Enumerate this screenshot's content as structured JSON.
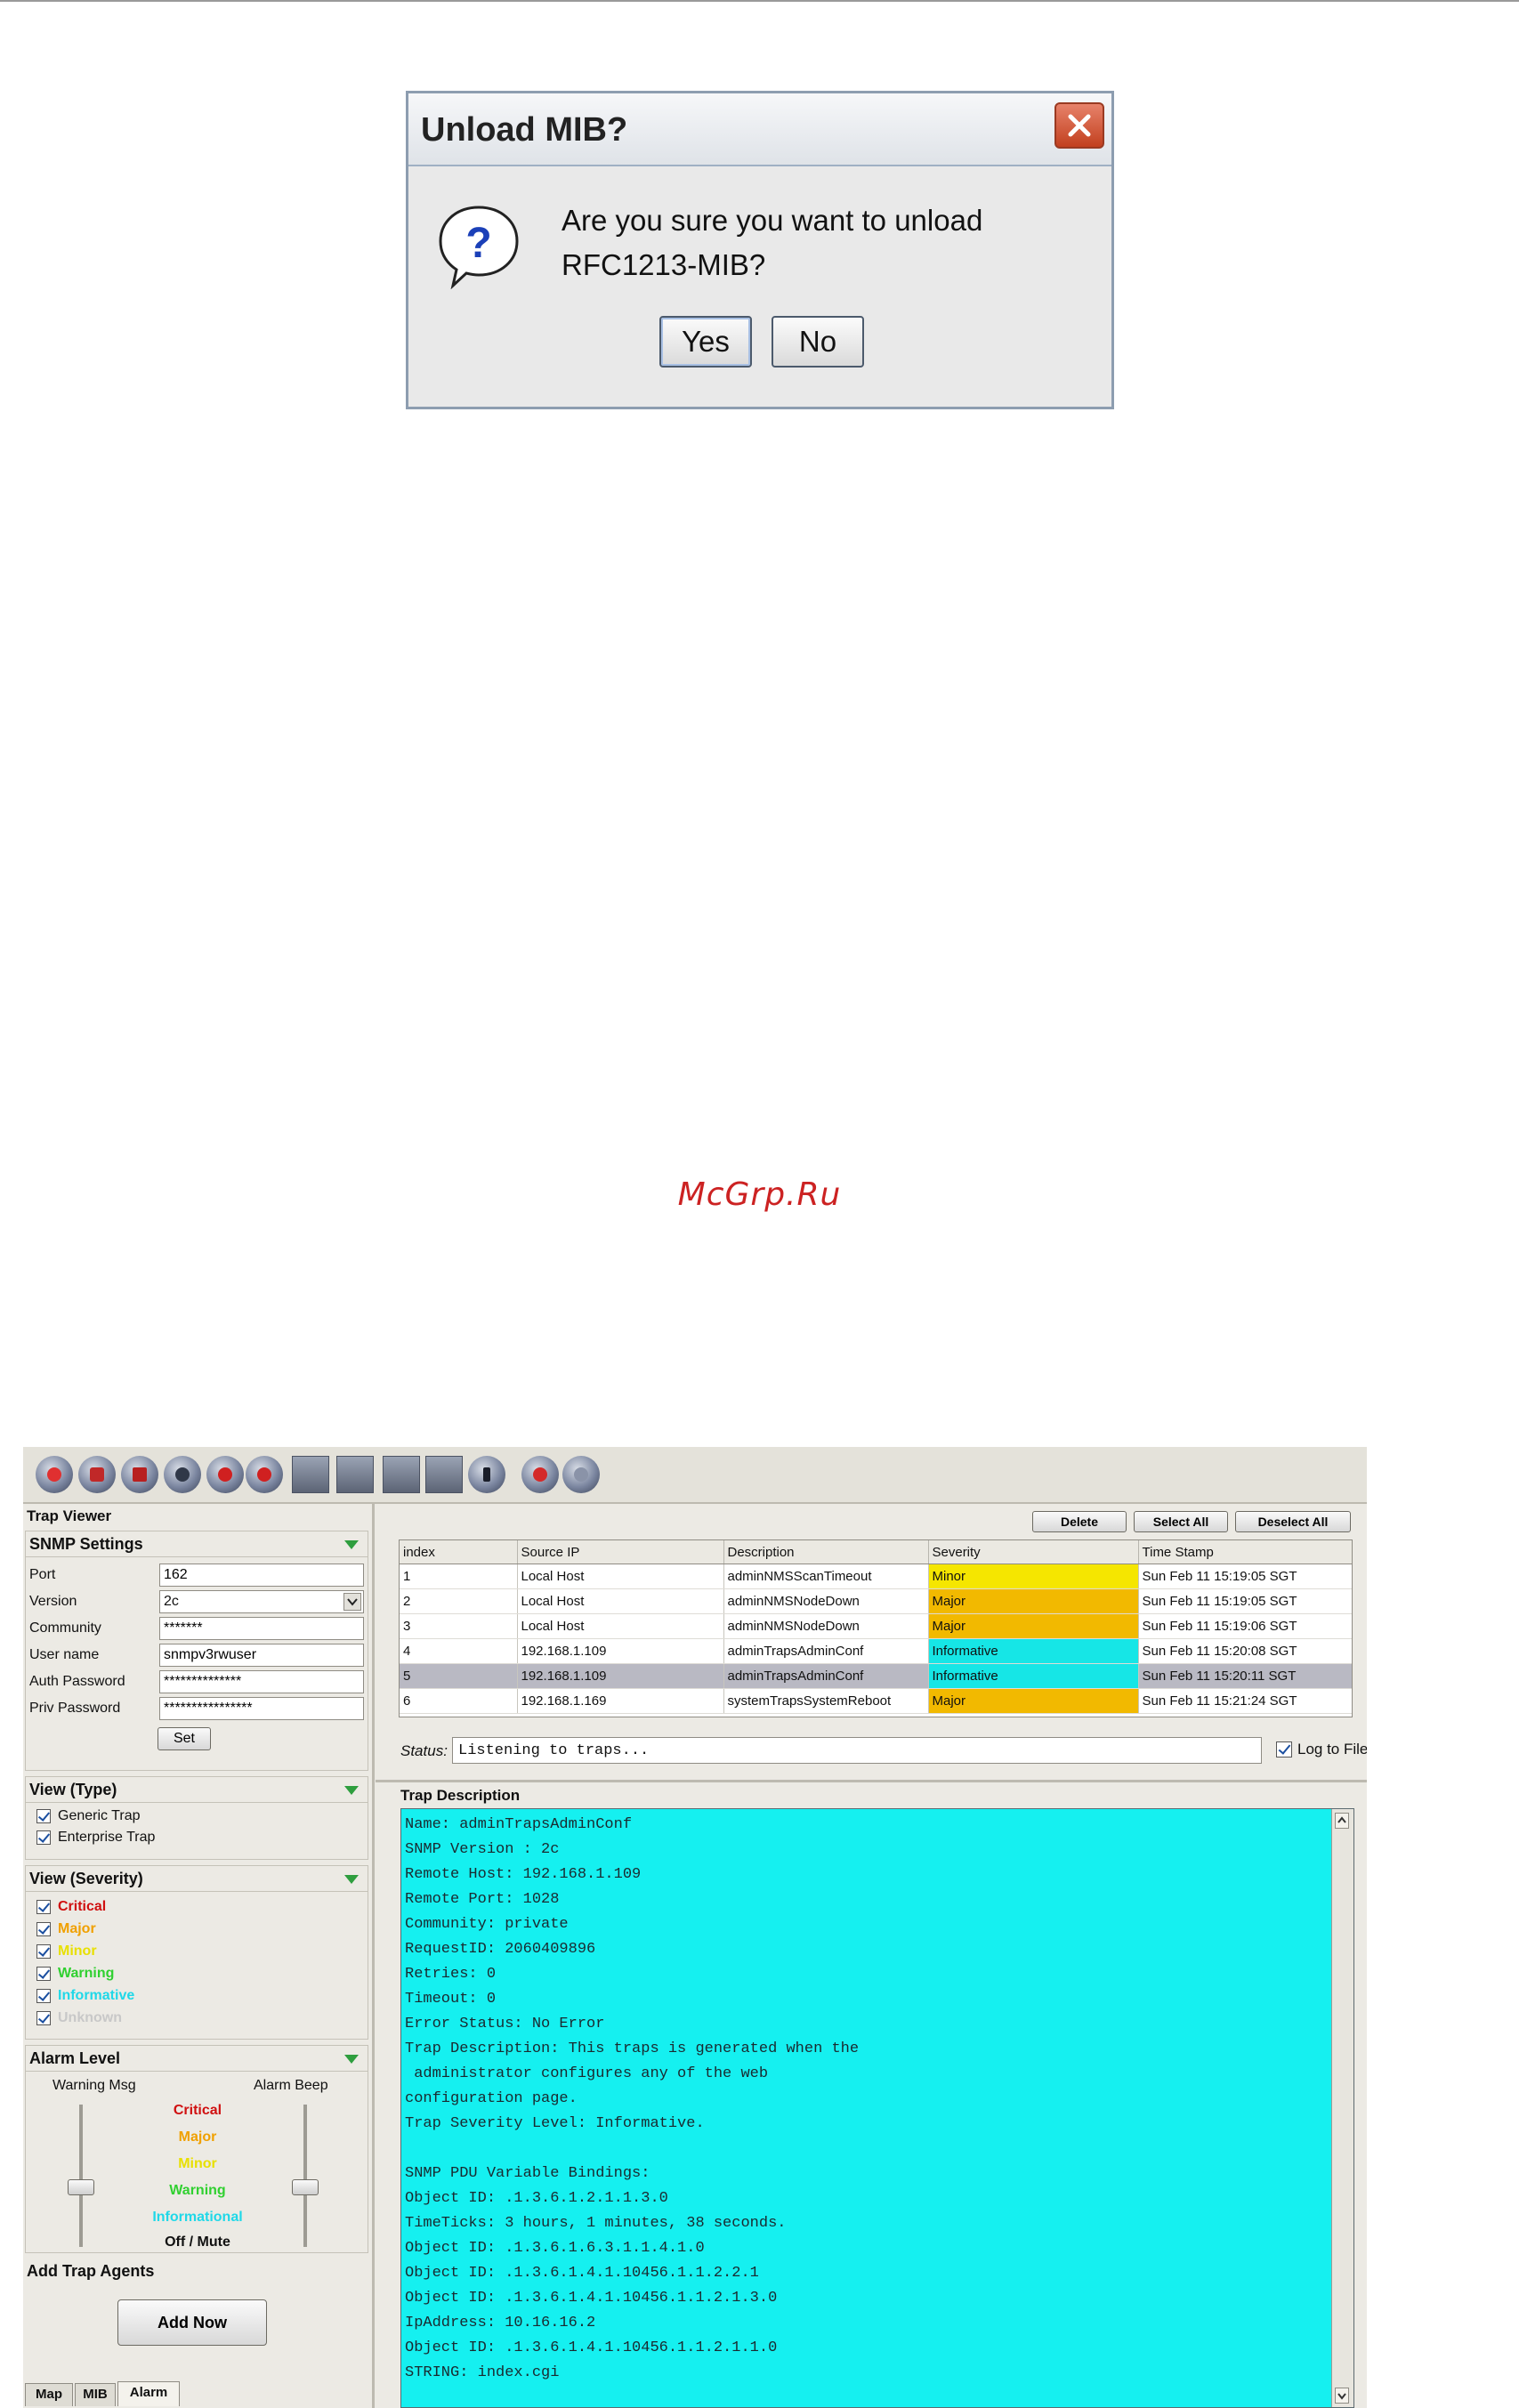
{
  "dialog": {
    "title": "Unload MIB?",
    "message_line1": "Are you sure you want to unload",
    "message_line2": "RFC1213-MIB?",
    "yes_label": "Yes",
    "no_label": "No",
    "icon": "question-icon"
  },
  "watermark": "McGrp.Ru",
  "app": {
    "panel_title": "Trap Viewer",
    "toolbar_icons": [
      "record-icon",
      "open-icon",
      "stop-icon",
      "save-icon",
      "back-icon",
      "forward-icon",
      "document-icon",
      "export-icon",
      "import-icon",
      "delete-icon",
      "info-icon",
      "help-icon",
      "about-icon"
    ],
    "snmp": {
      "title": "SNMP Settings",
      "port_label": "Port",
      "port_value": "162",
      "version_label": "Version",
      "version_value": "2c",
      "community_label": "Community",
      "community_value": "*******",
      "username_label": "User name",
      "username_value": "snmpv3rwuser",
      "authpw_label": "Auth Password",
      "authpw_value": "**************",
      "privpw_label": "Priv Password",
      "privpw_value": "****************",
      "set_label": "Set"
    },
    "view_type": {
      "title": "View (Type)",
      "items": [
        "Generic Trap",
        "Enterprise Trap"
      ]
    },
    "view_severity": {
      "title": "View (Severity)",
      "items": [
        "Critical",
        "Major",
        "Minor",
        "Warning",
        "Informative",
        "Unknown"
      ]
    },
    "alarm": {
      "title": "Alarm Level",
      "warning_msg": "Warning Msg",
      "alarm_beep": "Alarm Beep",
      "levels": [
        "Critical",
        "Major",
        "Minor",
        "Warning",
        "Informational",
        "Off / Mute"
      ]
    },
    "agents": {
      "title": "Add Trap Agents",
      "button": "Add Now"
    },
    "bottom_tabs": [
      "Map",
      "MIB",
      "Alarm"
    ],
    "buttons": {
      "delete": "Delete",
      "select_all": "Select All",
      "deselect_all": "Deselect All"
    },
    "table": {
      "columns": [
        "index",
        "Source IP",
        "Description",
        "Severity",
        "Time Stamp"
      ],
      "rows": [
        {
          "index": "1",
          "ip": "Local Host",
          "desc": "adminNMSScanTimeout",
          "sev": "Minor",
          "time": "Sun Feb 11 15:19:05 SGT"
        },
        {
          "index": "2",
          "ip": "Local Host",
          "desc": "adminNMSNodeDown",
          "sev": "Major",
          "time": "Sun Feb 11 15:19:05 SGT"
        },
        {
          "index": "3",
          "ip": "Local Host",
          "desc": "adminNMSNodeDown",
          "sev": "Major",
          "time": "Sun Feb 11 15:19:06 SGT"
        },
        {
          "index": "4",
          "ip": "192.168.1.109",
          "desc": "adminTrapsAdminConf",
          "sev": "Informative",
          "time": "Sun Feb 11 15:20:08 SGT"
        },
        {
          "index": "5",
          "ip": "192.168.1.109",
          "desc": "adminTrapsAdminConf",
          "sev": "Informative",
          "time": "Sun Feb 11 15:20:11 SGT"
        },
        {
          "index": "6",
          "ip": "192.168.1.169",
          "desc": "systemTrapsSystemReboot",
          "sev": "Major",
          "time": "Sun Feb 11 15:21:24 SGT"
        }
      ]
    },
    "severity_colors": {
      "Minor": "#f5e600",
      "Major": "#f2b900",
      "Informative": "#16e6e6"
    },
    "selected_row": 5,
    "status_label": "Status:",
    "status_value": "Listening to traps...",
    "log_to_file": "Log to File",
    "desc_title": "Trap Description",
    "desc_lines": [
      "Name: adminTrapsAdminConf",
      "SNMP Version : 2c",
      "Remote Host: 192.168.1.109",
      "Remote Port: 1028",
      "Community: private",
      "RequestID: 2060409896",
      "Retries: 0",
      "Timeout: 0",
      "Error Status: No Error",
      "Trap Description: This traps is generated when the",
      " administrator configures any of the web",
      "configuration page.",
      "Trap Severity Level: Informative.",
      "",
      "SNMP PDU Variable Bindings:",
      "Object ID: .1.3.6.1.2.1.1.3.0",
      "TimeTicks: 3 hours, 1 minutes, 38 seconds.",
      "Object ID: .1.3.6.1.6.3.1.1.4.1.0",
      "Object ID: .1.3.6.1.4.1.10456.1.1.2.2.1",
      "Object ID: .1.3.6.1.4.1.10456.1.1.2.1.3.0",
      "IpAddress: 10.16.16.2",
      "Object ID: .1.3.6.1.4.1.10456.1.1.2.1.1.0",
      "STRING: index.cgi"
    ]
  }
}
